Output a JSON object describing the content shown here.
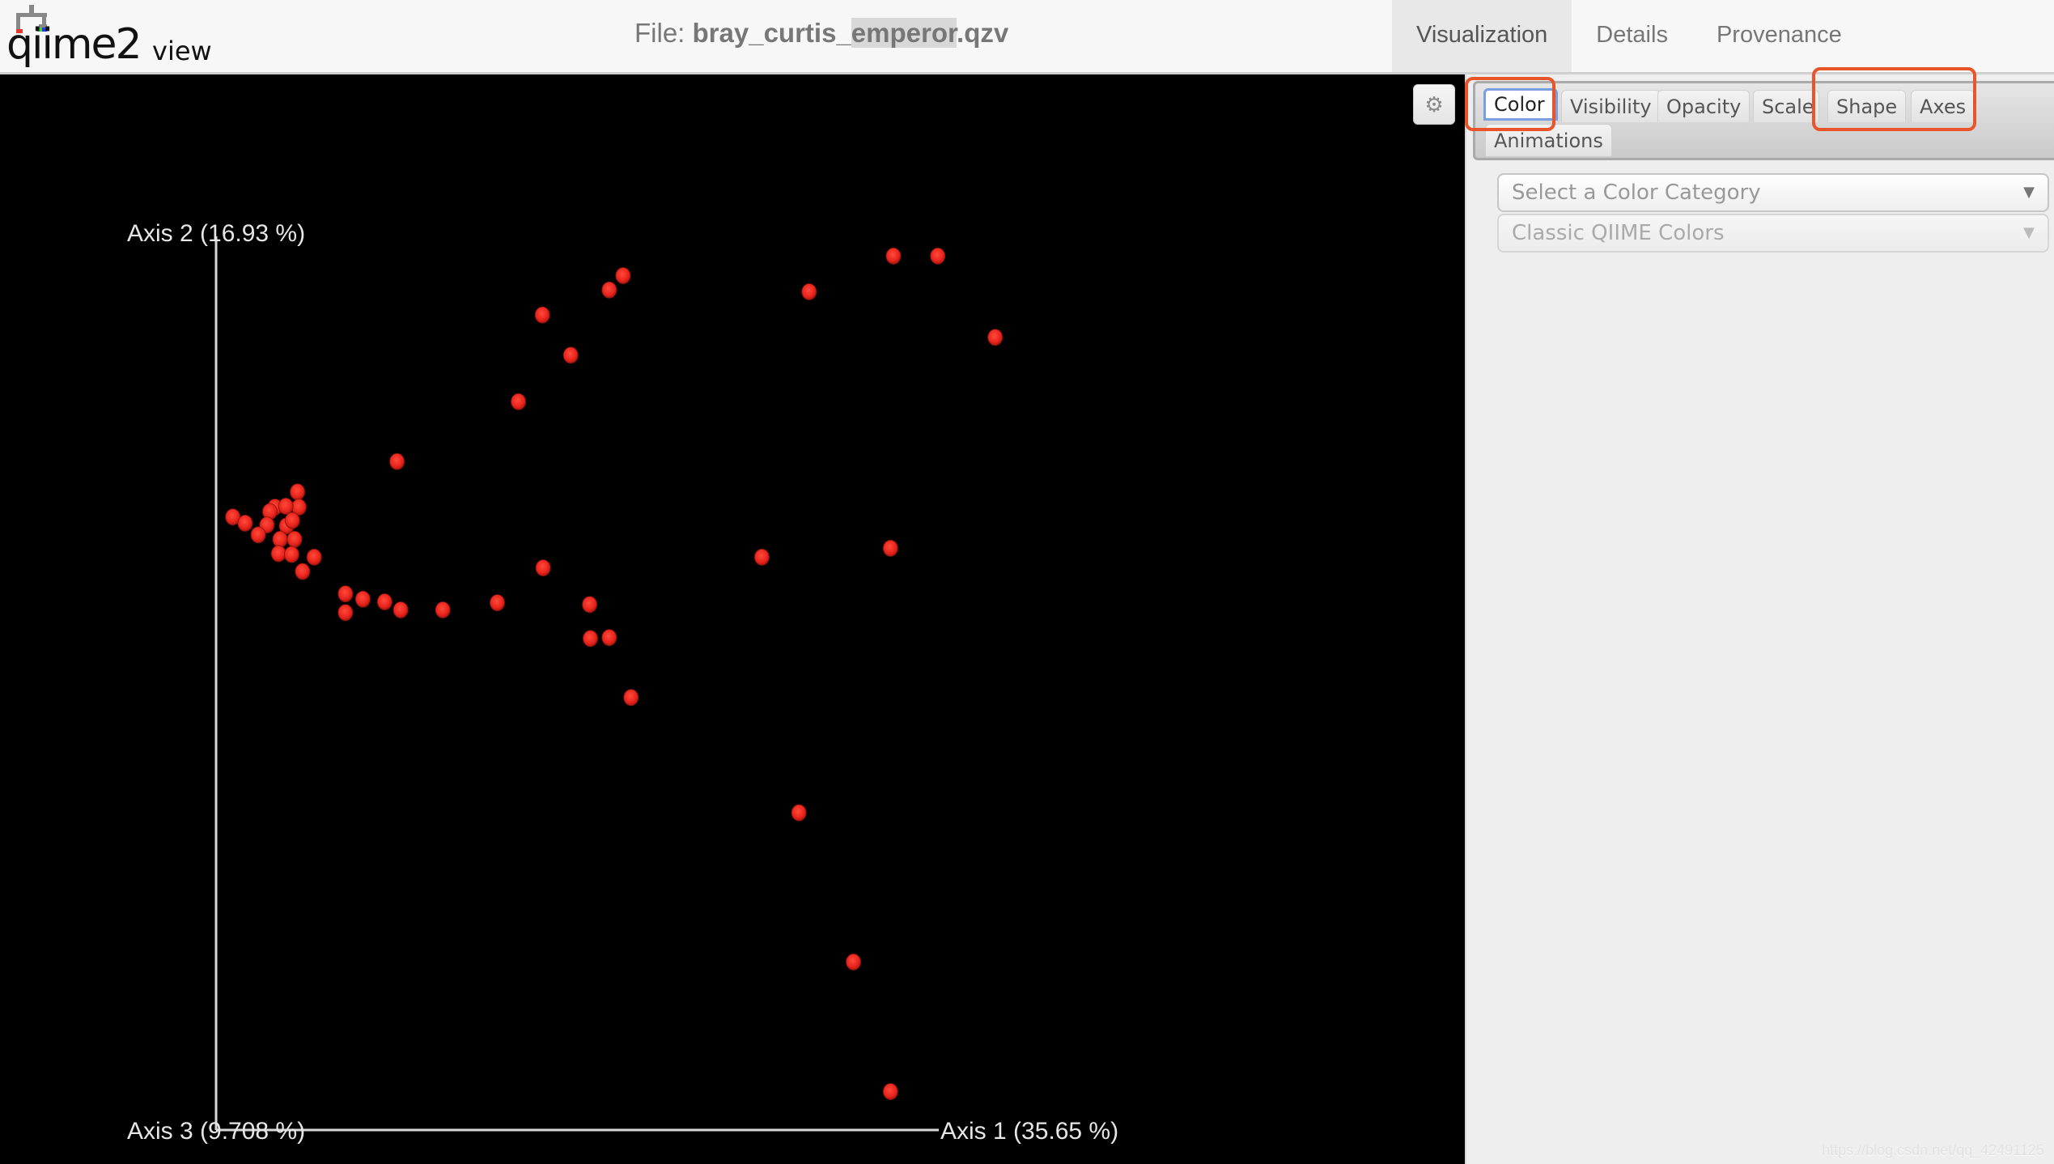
{
  "header": {
    "logo_text": "qiime2view",
    "logo_main": "qiime2",
    "logo_suffix": "view",
    "file_label": "File:",
    "file_name_prefix": "bray_curtis_",
    "file_name_selected": "emperor",
    "file_name_suffix": ".qzv",
    "nav_tabs": [
      {
        "label": "Visualization",
        "active": true
      },
      {
        "label": "Details",
        "active": false
      },
      {
        "label": "Provenance",
        "active": false
      }
    ]
  },
  "controls": {
    "settings_icon": "gear-icon",
    "tabs": [
      {
        "label": "Color",
        "active": true
      },
      {
        "label": "Visibility",
        "active": false
      },
      {
        "label": "Opacity",
        "active": false
      },
      {
        "label": "Scale",
        "active": false
      },
      {
        "label": "Shape",
        "active": false
      },
      {
        "label": "Axes",
        "active": false
      },
      {
        "label": "Animations",
        "active": false
      }
    ],
    "highlighted_tabs": [
      "Color",
      "Shape",
      "Axes"
    ],
    "color_category_placeholder": "Select a Color Category",
    "colormap_value": "Classic QIIME Colors",
    "highlight_color": "#e8552a"
  },
  "watermark": "https://blog.csdn.net/qq_42491125",
  "chart_data": {
    "type": "scatter",
    "title": "",
    "background": "#000000",
    "point_color": "#e8231c",
    "axes": {
      "horizontal": "Axis 1 (35.65 %)",
      "vertical": "Axis 2 (16.93 %)",
      "depth": "Axis 3 (9.708 %)"
    },
    "units_note": "positions are fractions of the visible Axis 1 / Axis 2 extents (0 = origin, 1 = axis end)",
    "xlim": [
      0,
      1.1
    ],
    "ylim": [
      0,
      1.0
    ],
    "points": [
      {
        "x": 0.932,
        "y": 0.978
      },
      {
        "x": 0.993,
        "y": 0.978
      },
      {
        "x": 0.816,
        "y": 0.938
      },
      {
        "x": 0.56,
        "y": 0.956
      },
      {
        "x": 0.541,
        "y": 0.94
      },
      {
        "x": 0.449,
        "y": 0.912
      },
      {
        "x": 1.072,
        "y": 0.887
      },
      {
        "x": 0.488,
        "y": 0.867
      },
      {
        "x": 0.416,
        "y": 0.815
      },
      {
        "x": 0.249,
        "y": 0.748
      },
      {
        "x": 0.112,
        "y": 0.714
      },
      {
        "x": 0.114,
        "y": 0.697
      },
      {
        "x": 0.081,
        "y": 0.697
      },
      {
        "x": 0.096,
        "y": 0.698
      },
      {
        "x": 0.074,
        "y": 0.692
      },
      {
        "x": 0.023,
        "y": 0.686
      },
      {
        "x": 0.04,
        "y": 0.679
      },
      {
        "x": 0.07,
        "y": 0.677
      },
      {
        "x": 0.097,
        "y": 0.676
      },
      {
        "x": 0.105,
        "y": 0.682
      },
      {
        "x": 0.058,
        "y": 0.666
      },
      {
        "x": 0.088,
        "y": 0.661
      },
      {
        "x": 0.108,
        "y": 0.661
      },
      {
        "x": 0.086,
        "y": 0.645
      },
      {
        "x": 0.104,
        "y": 0.644
      },
      {
        "x": 0.135,
        "y": 0.641
      },
      {
        "x": 0.119,
        "y": 0.625
      },
      {
        "x": 0.45,
        "y": 0.629
      },
      {
        "x": 0.751,
        "y": 0.641
      },
      {
        "x": 0.928,
        "y": 0.651
      },
      {
        "x": 0.178,
        "y": 0.6
      },
      {
        "x": 0.202,
        "y": 0.594
      },
      {
        "x": 0.232,
        "y": 0.591
      },
      {
        "x": 0.254,
        "y": 0.582
      },
      {
        "x": 0.312,
        "y": 0.582
      },
      {
        "x": 0.387,
        "y": 0.59
      },
      {
        "x": 0.514,
        "y": 0.588
      },
      {
        "x": 0.178,
        "y": 0.579
      },
      {
        "x": 0.515,
        "y": 0.55
      },
      {
        "x": 0.541,
        "y": 0.551
      },
      {
        "x": 0.571,
        "y": 0.484
      },
      {
        "x": 0.802,
        "y": 0.355
      },
      {
        "x": 0.877,
        "y": 0.188
      },
      {
        "x": 0.928,
        "y": 0.043
      }
    ]
  }
}
